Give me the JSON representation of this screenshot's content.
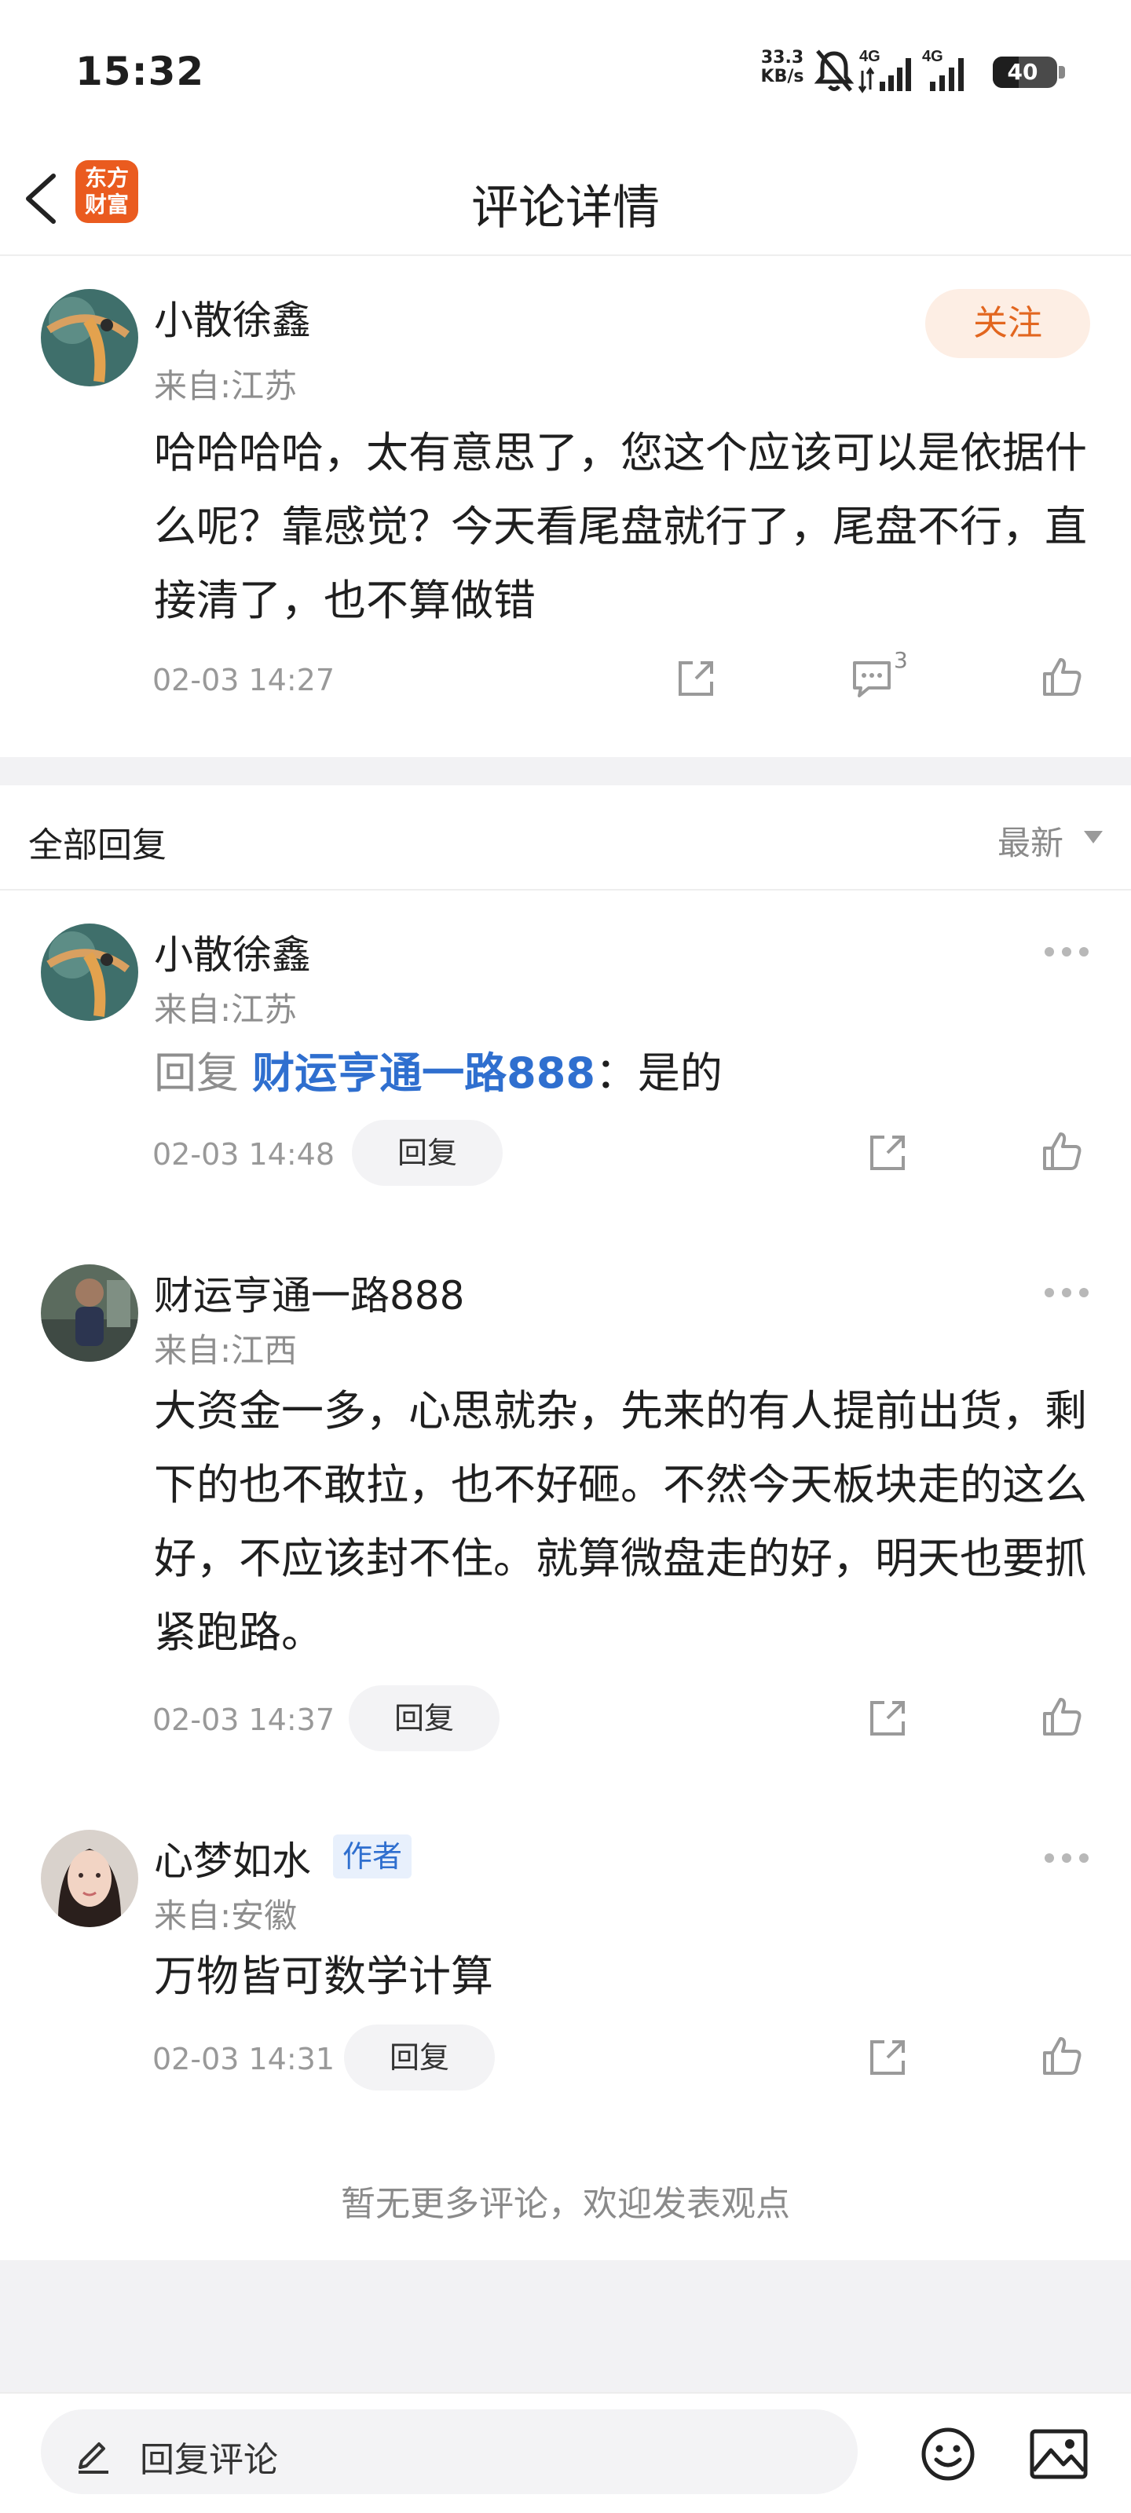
{
  "status_bar": {
    "time": "15:32",
    "net_speed_value": "33.3",
    "net_speed_unit": "KB/s",
    "signal1_label": "4G",
    "signal2_label": "4G",
    "battery_level": "40"
  },
  "header": {
    "title": "评论详情",
    "logo_line1": "东方",
    "logo_line2": "财富"
  },
  "main_comment": {
    "username": "小散徐鑫",
    "location": "来自:江苏",
    "follow_label": "关注",
    "text": "哈哈哈哈，太有意思了，您这个应该可以是依据什么呢？靠感觉？今天看尾盘就行了，尾盘不行，直接清了，也不算做错",
    "time": "02-03 14:27",
    "comment_count": "3"
  },
  "replies_section": {
    "title": "全部回复",
    "sort_label": "最新"
  },
  "replies": [
    {
      "username": "小散徐鑫",
      "location": "来自:江苏",
      "reply_prefix": "回复",
      "reply_target": "财运亨通一路888",
      "text": "：是的",
      "time": "02-03 14:48",
      "reply_button": "回复"
    },
    {
      "username": "财运亨通一路888",
      "location": "来自:江西",
      "text": "大资金一多，心思就杂，先来的有人提前出货，剩下的也不敢拉，也不好砸。不然今天板块走的这么好，不应该封不住。就算微盘走的好，明天也要抓紧跑路。",
      "time": "02-03 14:37",
      "reply_button": "回复"
    },
    {
      "username": "心梦如水",
      "author_badge": "作者",
      "location": "来自:安徽",
      "text": "万物皆可数学计算",
      "time": "02-03 14:31",
      "reply_button": "回复"
    }
  ],
  "no_more_text": "暂无更多评论，欢迎发表观点",
  "bottom_bar": {
    "input_placeholder": "回复评论"
  },
  "icons": {
    "share": "share-icon",
    "comment": "comment-icon",
    "like": "thumbs-up-icon",
    "more": "more-icon",
    "emoji": "emoji-icon",
    "image": "image-icon",
    "edit": "pencil-icon",
    "back": "chevron-left-icon"
  },
  "colors": {
    "accent_orange": "#e2661f",
    "follow_bg": "#fdeee4",
    "link_blue": "#2f6fcf",
    "logo_bg": "#ea5b1f"
  }
}
